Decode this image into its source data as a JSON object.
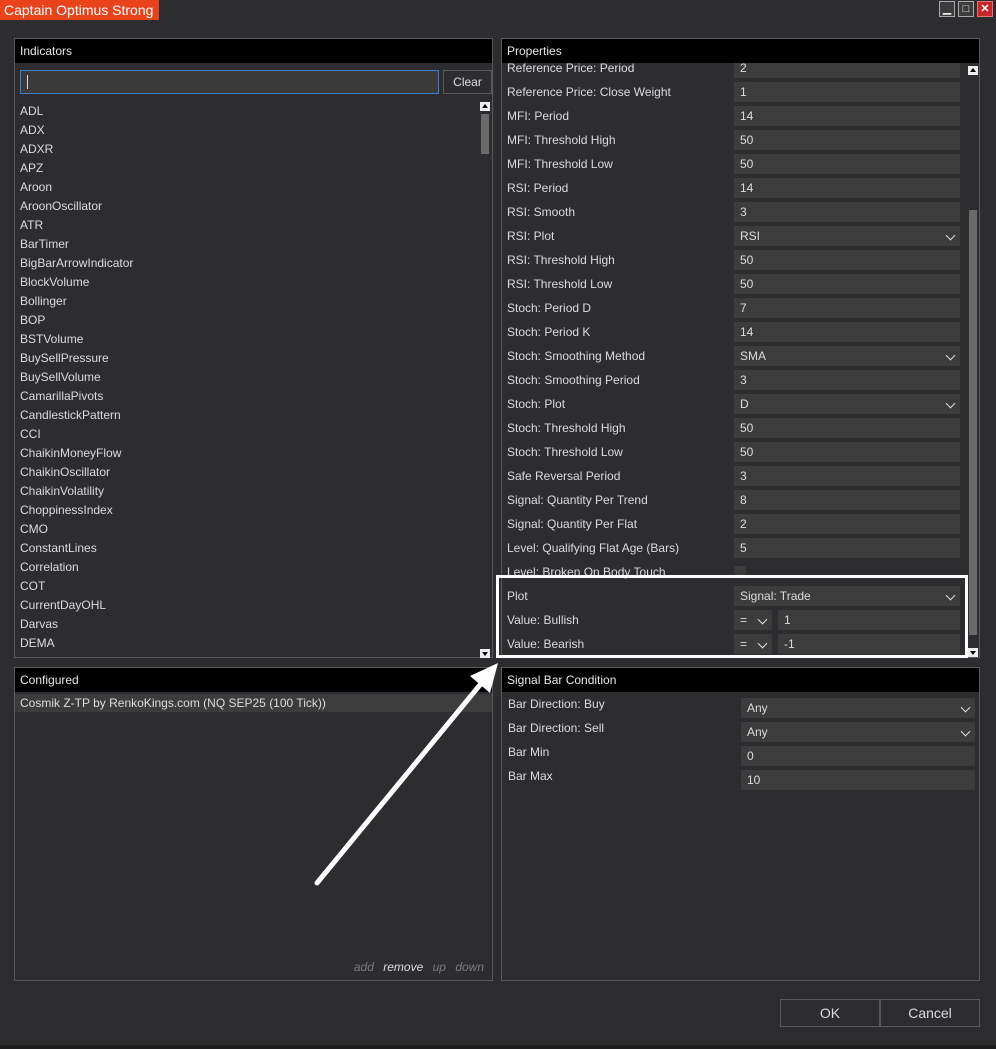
{
  "window": {
    "title": "Captain Optimus Strong",
    "minimize": "▁",
    "maximize": "□",
    "close": "✕"
  },
  "indicators": {
    "header": "Indicators",
    "search_value": "",
    "clear_label": "Clear",
    "items": [
      "ADL",
      "ADX",
      "ADXR",
      "APZ",
      "Aroon",
      "AroonOscillator",
      "ATR",
      "BarTimer",
      "BigBarArrowIndicator",
      "BlockVolume",
      "Bollinger",
      "BOP",
      "BSTVolume",
      "BuySellPressure",
      "BuySellVolume",
      "CamarillaPivots",
      "CandlestickPattern",
      "CCI",
      "ChaikinMoneyFlow",
      "ChaikinOscillator",
      "ChaikinVolatility",
      "ChoppinessIndex",
      "CMO",
      "ConstantLines",
      "Correlation",
      "COT",
      "CurrentDayOHL",
      "Darvas",
      "DEMA"
    ]
  },
  "configured": {
    "header": "Configured",
    "item": "Cosmik Z-TP by RenkoKings.com (NQ SEP25 (100 Tick))",
    "actions": {
      "add": "add",
      "remove": "remove",
      "up": "up",
      "down": "down"
    }
  },
  "properties": {
    "header": "Properties",
    "rows": [
      {
        "label": "Reference Price: Period",
        "value": "2"
      },
      {
        "label": "Reference Price: Close Weight",
        "value": "1"
      },
      {
        "label": "MFI: Period",
        "value": "14"
      },
      {
        "label": "MFI: Threshold High",
        "value": "50"
      },
      {
        "label": "MFI: Threshold Low",
        "value": "50"
      },
      {
        "label": "RSI: Period",
        "value": "14"
      },
      {
        "label": "RSI: Smooth",
        "value": "3"
      },
      {
        "label": "RSI: Plot",
        "value": "RSI"
      },
      {
        "label": "RSI: Threshold High",
        "value": "50"
      },
      {
        "label": "RSI: Threshold Low",
        "value": "50"
      },
      {
        "label": "Stoch: Period D",
        "value": "7"
      },
      {
        "label": "Stoch: Period K",
        "value": "14"
      },
      {
        "label": "Stoch: Smoothing Method",
        "value": "SMA"
      },
      {
        "label": "Stoch: Smoothing Period",
        "value": "3"
      },
      {
        "label": "Stoch: Plot",
        "value": "D"
      },
      {
        "label": "Stoch: Threshold High",
        "value": "50"
      },
      {
        "label": "Stoch: Threshold Low",
        "value": "50"
      },
      {
        "label": "Safe Reversal Period",
        "value": "3"
      },
      {
        "label": "Signal: Quantity Per Trend",
        "value": "8"
      },
      {
        "label": "Signal: Quantity Per Flat",
        "value": "2"
      },
      {
        "label": "Level: Qualifying Flat Age (Bars)",
        "value": "5"
      },
      {
        "label": "Level: Broken On Body Touch",
        "value": ""
      },
      {
        "label": "Plot",
        "value": "Signal: Trade"
      },
      {
        "label": "Value: Bullish",
        "operator": "=",
        "value": "1"
      },
      {
        "label": "Value: Bearish",
        "operator": "=",
        "value": "-1"
      }
    ]
  },
  "signal_bar": {
    "header": "Signal Bar Condition",
    "rows": [
      {
        "label": "Bar Direction: Buy",
        "value": "Any"
      },
      {
        "label": "Bar Direction: Sell",
        "value": "Any"
      },
      {
        "label": "Bar Min",
        "value": "0"
      },
      {
        "label": "Bar Max",
        "value": "10"
      }
    ]
  },
  "buttons": {
    "ok": "OK",
    "cancel": "Cancel"
  },
  "colors": {
    "title_accent": "#e8431a",
    "background": "#2d2d30",
    "field": "#3c3c3c",
    "header": "#000000",
    "highlight": "#ffffff"
  }
}
